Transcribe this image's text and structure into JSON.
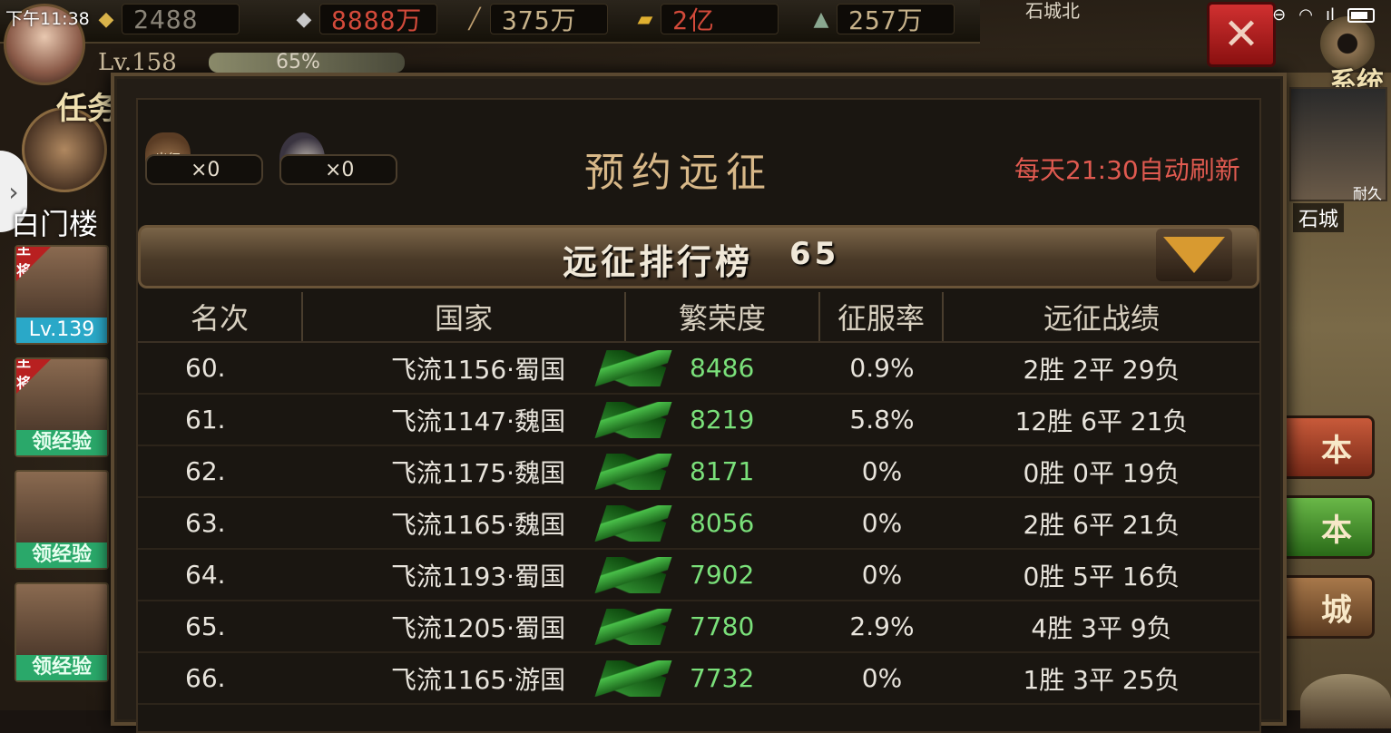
{
  "status_bar": {
    "time": "下午11:38"
  },
  "resources": [
    {
      "icon": "gold-ingot-icon",
      "value": "2488",
      "style": "gray"
    },
    {
      "icon": "silver-ingot-icon",
      "value": "8888万",
      "style": "red"
    },
    {
      "icon": "wood-icon",
      "value": "375万",
      "style": "amber"
    },
    {
      "icon": "gold-bar-icon",
      "value": "2亿",
      "style": "red"
    },
    {
      "icon": "ore-icon",
      "value": "257万",
      "style": "amber"
    }
  ],
  "player": {
    "level": "Lv.158",
    "exp_percent": "65%"
  },
  "left_panel": {
    "task_label": "任务",
    "gate_label": "白门楼",
    "heroes": [
      {
        "tag": "主将",
        "badge": "Lv.139"
      },
      {
        "tag": "主将",
        "badge": "领经验"
      },
      {
        "tag": "",
        "badge": "领经验"
      },
      {
        "tag": "",
        "badge": "领经验"
      }
    ]
  },
  "right_panel": {
    "system_label": "系统",
    "city_top_label": "石城北",
    "city_durability": "耐久",
    "city_name": "石城",
    "side_buttons": [
      "本",
      "本",
      "城"
    ]
  },
  "dialog": {
    "title": "预约远征",
    "refresh_note": "每天21:30自动刷新",
    "counters": [
      {
        "icon": "expedition-bag-icon",
        "icon_text": "出征",
        "value": "×0"
      },
      {
        "icon": "potion-icon",
        "icon_text": "",
        "value": "×0"
      }
    ],
    "ranking": {
      "title": "远征排行榜",
      "my_rank": "65",
      "columns": [
        "名次",
        "国家",
        "繁荣度",
        "征服率",
        "远征战绩"
      ],
      "rows": [
        {
          "rank": "60.",
          "nation": "飞流1156·蜀国",
          "prosperity": "8486",
          "conquest": "0.9%",
          "record": "2胜 2平 29负"
        },
        {
          "rank": "61.",
          "nation": "飞流1147·魏国",
          "prosperity": "8219",
          "conquest": "5.8%",
          "record": "12胜 6平 21负"
        },
        {
          "rank": "62.",
          "nation": "飞流1175·魏国",
          "prosperity": "8171",
          "conquest": "0%",
          "record": "0胜 0平 19负"
        },
        {
          "rank": "63.",
          "nation": "飞流1165·魏国",
          "prosperity": "8056",
          "conquest": "0%",
          "record": "2胜 6平 21负"
        },
        {
          "rank": "64.",
          "nation": "飞流1193·蜀国",
          "prosperity": "7902",
          "conquest": "0%",
          "record": "0胜 5平 16负"
        },
        {
          "rank": "65.",
          "nation": "飞流1205·蜀国",
          "prosperity": "7780",
          "conquest": "2.9%",
          "record": "4胜 3平 9负"
        },
        {
          "rank": "66.",
          "nation": "飞流1165·游国",
          "prosperity": "7732",
          "conquest": "0%",
          "record": "1胜 3平 25负"
        }
      ]
    }
  },
  "colors": {
    "prosperity_value": "#7ae07a",
    "refresh_note": "#e05a50",
    "title": "#d8b888"
  }
}
